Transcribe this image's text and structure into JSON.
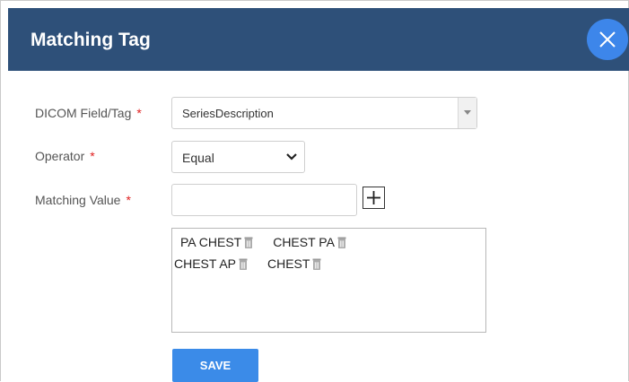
{
  "dialog": {
    "title": "Matching Tag"
  },
  "form": {
    "dicom_field": {
      "label": "DICOM Field/Tag",
      "required_mark": "*",
      "value": "SeriesDescription"
    },
    "operator": {
      "label": "Operator",
      "required_mark": "*",
      "value": "Equal"
    },
    "matching_value": {
      "label": "Matching Value",
      "required_mark": "*",
      "value": "",
      "values": [
        "PA CHEST",
        "CHEST PA",
        "CHEST AP",
        "CHEST"
      ]
    },
    "save_label": "SAVE"
  },
  "icons": {
    "close": "close-icon",
    "add": "plus-icon",
    "remove": "trash-icon",
    "dropdown": "chevron-down-icon"
  },
  "colors": {
    "header": "#2e5079",
    "close": "#3d86ea",
    "save": "#3b8be8",
    "required": "#e02020"
  }
}
